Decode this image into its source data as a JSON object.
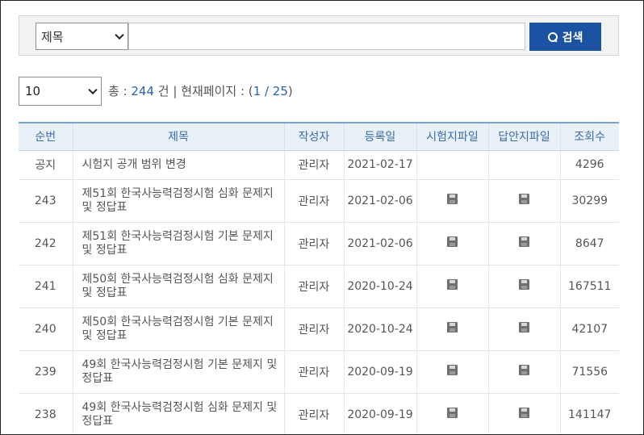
{
  "search": {
    "field_select": "제목",
    "query_value": "",
    "query_placeholder": "",
    "button_label": "검색"
  },
  "pager": {
    "page_size": "10",
    "total_prefix": "총 : ",
    "total_count": "244",
    "total_suffix": " 건 | 현재페이지 : (",
    "current_page": "1",
    "page_separator": " / ",
    "total_pages": "25",
    "page_suffix": ")"
  },
  "table": {
    "headers": [
      "순번",
      "제목",
      "작성자",
      "등록일",
      "시험지파일",
      "답안지파일",
      "조회수"
    ],
    "rows": [
      {
        "no": "공지",
        "title": "시험지 공개 범위 변경",
        "author": "관리자",
        "date": "2021-02-17",
        "exam_file": false,
        "answer_file": false,
        "views": "4296"
      },
      {
        "no": "243",
        "title": "제51회 한국사능력검정시험 심화 문제지 및 정답표",
        "author": "관리자",
        "date": "2021-02-06",
        "exam_file": true,
        "answer_file": true,
        "views": "30299"
      },
      {
        "no": "242",
        "title": "제51회 한국사능력검정시험 기본 문제지 및 정답표",
        "author": "관리자",
        "date": "2021-02-06",
        "exam_file": true,
        "answer_file": true,
        "views": "8647"
      },
      {
        "no": "241",
        "title": "제50회 한국사능력검정시험 심화 문제지 및 정답표",
        "author": "관리자",
        "date": "2020-10-24",
        "exam_file": true,
        "answer_file": true,
        "views": "167511"
      },
      {
        "no": "240",
        "title": "제50회 한국사능력검정시험 기본 문제지 및 정답표",
        "author": "관리자",
        "date": "2020-10-24",
        "exam_file": true,
        "answer_file": true,
        "views": "42107"
      },
      {
        "no": "239",
        "title": "49회 한국사능력검정시험 기본 문제지 및 정답표",
        "author": "관리자",
        "date": "2020-09-19",
        "exam_file": true,
        "answer_file": true,
        "views": "71556"
      },
      {
        "no": "238",
        "title": "49회 한국사능력검정시험 심화 문제지 및 정답표",
        "author": "관리자",
        "date": "2020-09-19",
        "exam_file": true,
        "answer_file": true,
        "views": "141147"
      }
    ]
  },
  "icons": {
    "search_button": "search-icon",
    "file": "floppy-disk-icon"
  },
  "colors": {
    "accent": "#1c52a2",
    "header_text": "#3b6aa5",
    "header_bg": "#e8f1f8",
    "count_text": "#2a63ad"
  }
}
